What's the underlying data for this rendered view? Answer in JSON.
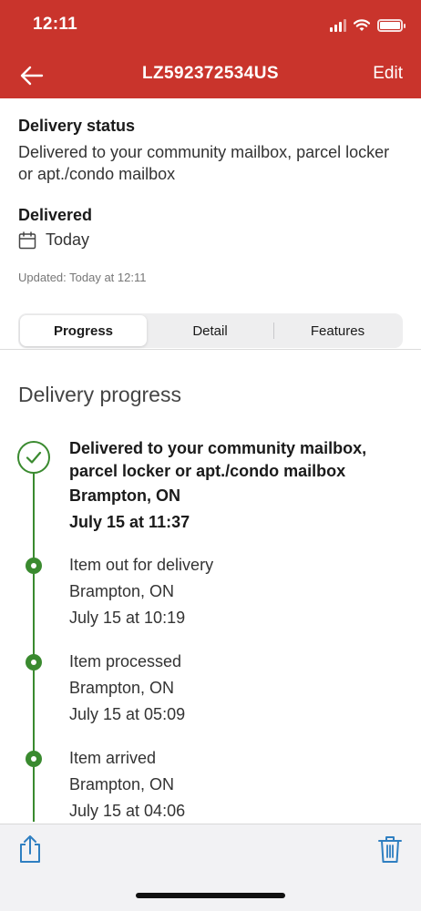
{
  "status_bar": {
    "time": "12:11"
  },
  "nav": {
    "title": "LZ592372534US",
    "edit_label": "Edit"
  },
  "delivery_status": {
    "heading": "Delivery status",
    "text": "Delivered to your community mailbox, parcel locker or apt./condo mailbox",
    "state": "Delivered",
    "date": "Today",
    "updated": "Updated: Today at 12:11"
  },
  "tabs": [
    {
      "label": "Progress",
      "active": true
    },
    {
      "label": "Detail",
      "active": false
    },
    {
      "label": "Features",
      "active": false
    }
  ],
  "progress": {
    "title": "Delivery progress",
    "events": [
      {
        "description": "Delivered to your community mailbox, parcel locker or apt./condo mailbox",
        "location": "Brampton, ON",
        "time": "July 15 at 11:37",
        "icon": "check-circle-icon"
      },
      {
        "description": "Item out for delivery",
        "location": "Brampton, ON",
        "time": "July 15 at 10:19",
        "icon": "dot-icon"
      },
      {
        "description": "Item processed",
        "location": "Brampton, ON",
        "time": "July 15 at 05:09",
        "icon": "dot-icon"
      },
      {
        "description": "Item arrived",
        "location": "Brampton, ON",
        "time": "July 15 at 04:06",
        "icon": "dot-icon"
      }
    ]
  },
  "colors": {
    "header": "#c9342c",
    "timeline_green": "#3a8a2f",
    "action_blue": "#2f7fc1"
  },
  "toolbar": {
    "share_icon": "share-icon",
    "trash_icon": "trash-icon"
  }
}
